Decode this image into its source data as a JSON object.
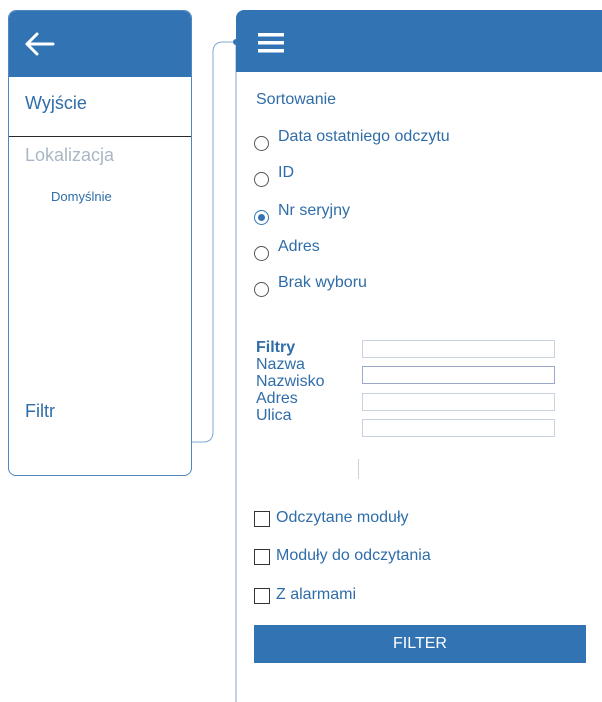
{
  "left_menu": {
    "back_icon": "arrow-left-icon",
    "exit_label": "Wyjście",
    "location_label": "Lokalizacja",
    "default_label": "Domyślnie",
    "filter_label": "Filtr"
  },
  "right_panel": {
    "menu_icon": "hamburger-icon",
    "sort_title": "Sortowanie",
    "sort_options": [
      {
        "label": "Data ostatniego odczytu",
        "checked": false
      },
      {
        "label": "ID",
        "checked": false
      },
      {
        "label": "Nr seryjny",
        "checked": true
      },
      {
        "label": "Adres",
        "checked": false
      },
      {
        "label": "Brak wyboru",
        "checked": false
      }
    ],
    "filters": {
      "title": "Filtry",
      "labels": [
        "Nazwa",
        "Nazwisko",
        "Adres",
        "Ulica"
      ],
      "values": [
        "",
        "",
        "",
        ""
      ]
    },
    "checkboxes": [
      {
        "label": "Odczytane moduły",
        "checked": false
      },
      {
        "label": "Moduły do odczytania",
        "checked": false
      },
      {
        "label": "Z alarmami",
        "checked": false
      }
    ],
    "filter_button_label": "FILTER"
  },
  "colors": {
    "primary": "#3273b3",
    "text": "#2f6da8",
    "muted": "#a9b7c7"
  }
}
